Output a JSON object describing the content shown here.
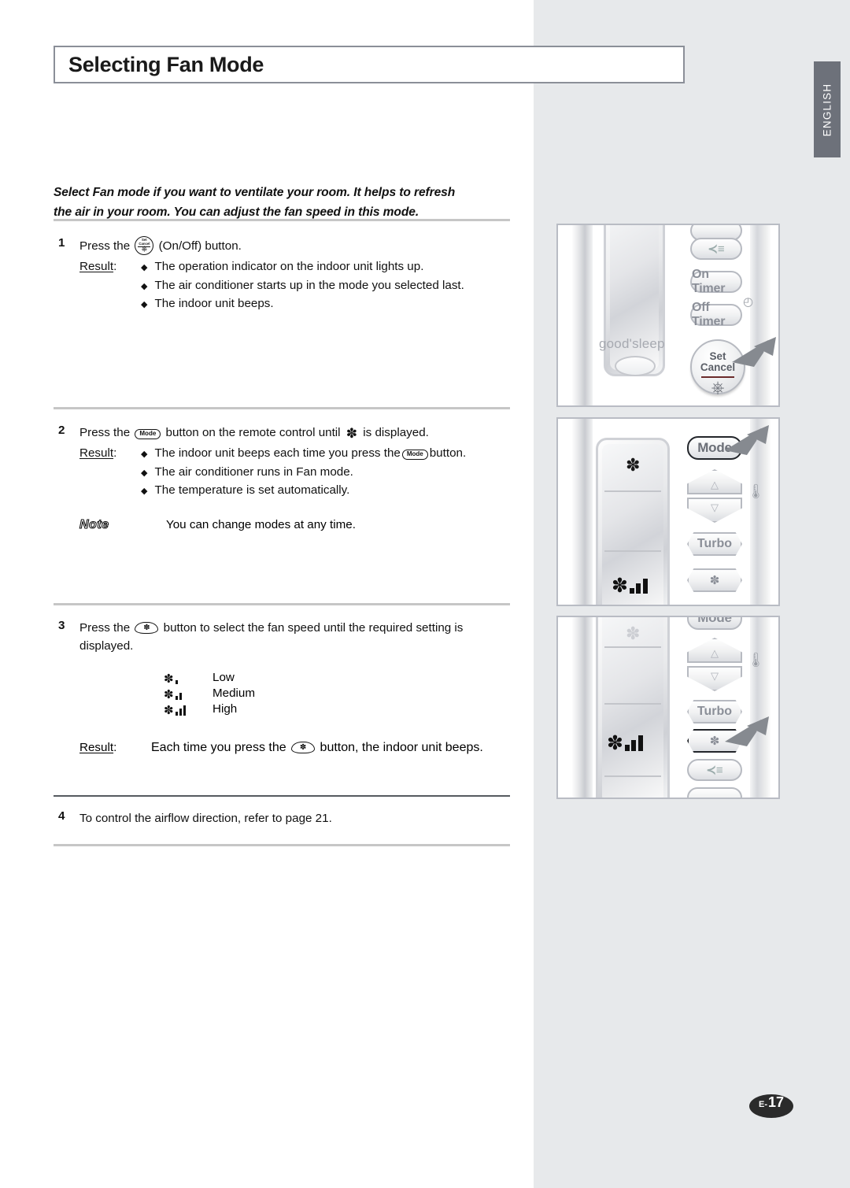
{
  "document": {
    "title": "Selecting Fan Mode",
    "language_tab": "ENGLISH",
    "page_number_prefix": "E-",
    "page_number": "17",
    "intro_line1": "Select Fan mode if you want to ventilate your room. It helps to refresh",
    "intro_line2": "the air in your room. You can adjust the fan speed in this mode."
  },
  "steps": {
    "step1": {
      "number": "1",
      "text_before_icon": "Press the",
      "icon": "onoff-button-icon",
      "text_after_icon": "(On/Off) button.",
      "result_label": "Result",
      "result_colon": ":",
      "results": [
        "The operation indicator on the indoor unit lights up.",
        "The air conditioner starts up in the mode you selected last.",
        "The indoor unit beeps."
      ]
    },
    "step2": {
      "number": "2",
      "text_a": "Press the",
      "icon_mode": "Mode",
      "text_b": "button on the remote control until",
      "icon_fan": "fan-icon",
      "text_c": "is displayed.",
      "result_label": "Result",
      "result_colon": ":",
      "results": [
        {
          "a": "The indoor unit beeps each time you press the",
          "chip": "Mode",
          "b": "button."
        },
        {
          "a": "The air conditioner runs in Fan mode.",
          "chip": "",
          "b": ""
        },
        {
          "a": "The temperature is set automatically.",
          "chip": "",
          "b": ""
        }
      ],
      "note_badge": "Note",
      "note_text": "You can change modes at any time."
    },
    "step3": {
      "number": "3",
      "text_a": "Press the",
      "icon_fanspeed": "fan-speed-button-icon",
      "text_b": "button to select the fan speed until the required setting is",
      "text_c": "displayed.",
      "speeds": [
        {
          "bars": 1,
          "label": "Low"
        },
        {
          "bars": 2,
          "label": "Medium"
        },
        {
          "bars": 3,
          "label": "High"
        }
      ],
      "result_label": "Result",
      "result_colon": ":",
      "result_a": "Each time you press the",
      "result_chip": "fan-speed-button-icon",
      "result_b": "button, the indoor unit beeps."
    },
    "step4": {
      "number": "4",
      "text": "To control the airflow direction, refer to page 21."
    }
  },
  "illustrations": {
    "panel1": {
      "name": "remote-control-onoff-illustration",
      "display_label": "good'sleep",
      "buttons": [
        {
          "label": "",
          "name": "airflow-button"
        },
        {
          "label": "On Timer",
          "name": "on-timer-button"
        },
        {
          "label": "Off Timer",
          "name": "off-timer-button"
        },
        {
          "label_top": "Set",
          "label_bottom": "Cancel",
          "name": "set-cancel-power-button"
        }
      ],
      "clock_icon": "clock-icon",
      "highlight": "set-cancel-power-button"
    },
    "panel2": {
      "name": "remote-control-mode-illustration",
      "buttons": [
        {
          "label": "Mode",
          "name": "mode-button"
        },
        {
          "label": "",
          "name": "temp-up-button"
        },
        {
          "label": "",
          "name": "temp-down-button"
        },
        {
          "label": "Turbo",
          "name": "turbo-button"
        },
        {
          "label": "",
          "name": "fan-speed-button"
        }
      ],
      "thermo_icon": "thermometer-icon",
      "display_fan_icon": "fan-icon",
      "highlight": "mode-button"
    },
    "panel3": {
      "name": "remote-control-fanspeed-illustration",
      "buttons": [
        {
          "label": "Mode",
          "name": "mode-button"
        },
        {
          "label": "",
          "name": "temp-up-button"
        },
        {
          "label": "",
          "name": "temp-down-button"
        },
        {
          "label": "Turbo",
          "name": "turbo-button"
        },
        {
          "label": "",
          "name": "fan-speed-button"
        },
        {
          "label": "",
          "name": "airflow-button"
        }
      ],
      "thermo_icon": "thermometer-icon",
      "display_fanspeed_bars": 3,
      "highlight": "fan-speed-button"
    }
  },
  "colors": {
    "right_column_bg": "#e7e9eb",
    "lang_tab_bg": "#6d717a",
    "rule": "#c6c6c6",
    "rule_dark": "#555a60",
    "title_border": "#8b8f98",
    "page_badge_bg": "#2b2b2b"
  }
}
